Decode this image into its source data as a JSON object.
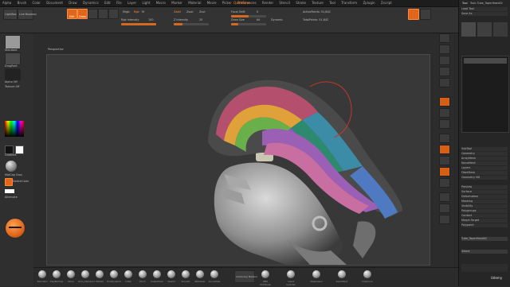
{
  "menubar": {
    "items": [
      "Alpha",
      "Brush",
      "Color",
      "Document",
      "Draw",
      "Dynamics",
      "Edit",
      "File",
      "Layer",
      "Light",
      "Macro",
      "Marker",
      "Material",
      "Movie",
      "Picker",
      "Preferences",
      "Render",
      "Stencil",
      "Stroke",
      "Texture",
      "Tool",
      "Transform",
      "Zplugin",
      "Zscript"
    ],
    "quicksave": "QuickSave",
    "tool_title": "Tool: Tube_TaperHead02"
  },
  "shelf": {
    "lightbox": "LightBox",
    "liveboolean": "Live Boolean",
    "edit": "Edit",
    "draw": "Draw",
    "move": "Move",
    "scale": "Scale",
    "rotate": "Rotate",
    "mrgb": "Mrgb",
    "rgb": "Rgb",
    "m": "M",
    "zadd": "Zadd",
    "zsub": "Zsub",
    "zcut": "Zcut",
    "focal_label": "Focal Shift",
    "focal_value": "0",
    "draw_size_label": "Draw Size",
    "draw_size_value": "64",
    "dynamic": "Dynamic",
    "rgb_intensity_label": "Rgb Intensity",
    "rgb_intensity_value": "100",
    "z_intensity_label": "Z Intensity",
    "z_intensity_value": "25",
    "active_points": "ActivePoints: 51,842",
    "total_points": "TotalPoints: 51,842"
  },
  "lefttray": {
    "brush_name": "Standard",
    "stroke": "DragRect",
    "alpha": "Alpha Off",
    "texture": "Texture Off",
    "material": "MatCap Gray",
    "gradient": "Gradient",
    "switch_color": "SwitchColor",
    "alternate": "Alternate"
  },
  "canvas": {
    "view_label": "Perspective"
  },
  "rightpal": {
    "title": "Tool",
    "rows": [
      "Load Tool",
      "Save As",
      "Import",
      "Export",
      "Clone",
      "Make PolyMesh3D",
      "GoZ",
      "All",
      "Visible",
      "R",
      "Lightbox ▸ Tools",
      "Tube_TaperHead02",
      "SubTool",
      "Geometry",
      "ArrayMesh",
      "NanoMesh",
      "Layers",
      "FiberMesh",
      "Geometry HD",
      "Preview",
      "Surface",
      "Deformation",
      "Masking",
      "Visibility",
      "Polygroups",
      "Contact",
      "Morph Target",
      "Polypaint",
      "UV Map",
      "Texture Map",
      "Displacement Map",
      "Normal Map"
    ],
    "footer_a": "Tube_TaperHead02",
    "footer_b": "Select",
    "watermark": "Udemy"
  },
  "bottom": {
    "brushes": [
      "Standard",
      "ClayBuildup",
      "Move",
      "Dam_Standard",
      "hPolish",
      "TrimDynamic",
      "Inflat",
      "Pinch",
      "SnakeHook",
      "Slash3",
      "Smooth",
      "ZModeler",
      "CurveTube",
      "IMM Primitives",
      "Insert Cylinder",
      "MaskLasso",
      "SelectRect",
      "ClipCurve"
    ],
    "picked": "AutoGroup Masked"
  },
  "colors": {
    "accent": "#e0661b",
    "canvas": "#383838",
    "panel": "#2f2f2f"
  }
}
